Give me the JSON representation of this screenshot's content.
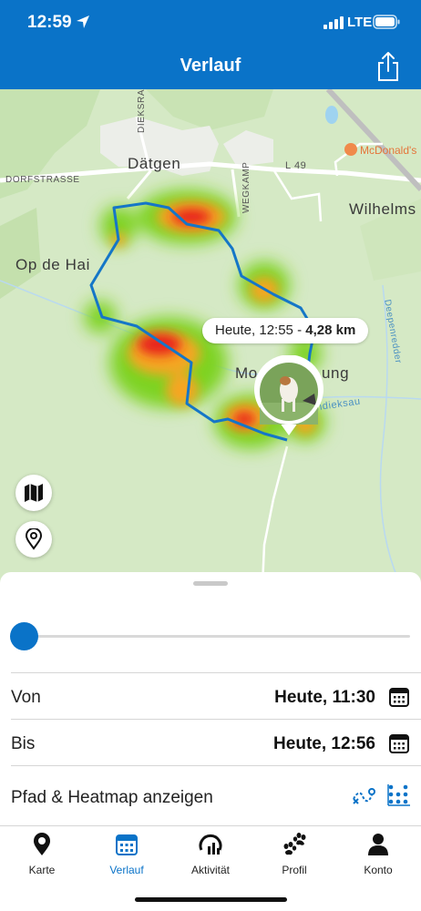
{
  "status_bar": {
    "time": "12:59",
    "network": "LTE"
  },
  "header": {
    "title": "Verlauf",
    "share_icon": "share-icon"
  },
  "map": {
    "labels": {
      "town": "Dätgen",
      "op_de_hai": "Op de Hai",
      "wilhelms": "Wilhelms",
      "mo_prefix": "Mo",
      "mo_suffix": "ung",
      "mcdonalds": "McDonald's",
      "dorfstrasse": "DORFSTRASSE",
      "l49": "L 49",
      "dieksrade": "DIEKSRADE",
      "wegkamp": "WEGKAMP",
      "deepenredder": "Deepenredder",
      "dieksau": "ndieksau"
    },
    "tooltip": {
      "prefix": "Heute, 12:55 - ",
      "distance": "4,28 km"
    },
    "buttons": {
      "map_layers": "map-icon",
      "location": "location-pin-icon"
    },
    "colors": {
      "track": "#1576c7",
      "heat_high": "#e8201a",
      "heat_mid": "#f5a623",
      "heat_low": "#7ed321"
    }
  },
  "panel": {
    "from_label": "Von",
    "from_value": "Heute, 11:30",
    "to_label": "Bis",
    "to_value": "Heute, 12:56",
    "toggle_label": "Pfad & Heatmap anzeigen"
  },
  "tabs": [
    {
      "label": "Karte",
      "icon": "map-pin-icon"
    },
    {
      "label": "Verlauf",
      "icon": "calendar-icon"
    },
    {
      "label": "Aktivität",
      "icon": "activity-gauge-icon"
    },
    {
      "label": "Profil",
      "icon": "paw-icon"
    },
    {
      "label": "Konto",
      "icon": "person-icon"
    }
  ],
  "accent": "#0a73c8"
}
